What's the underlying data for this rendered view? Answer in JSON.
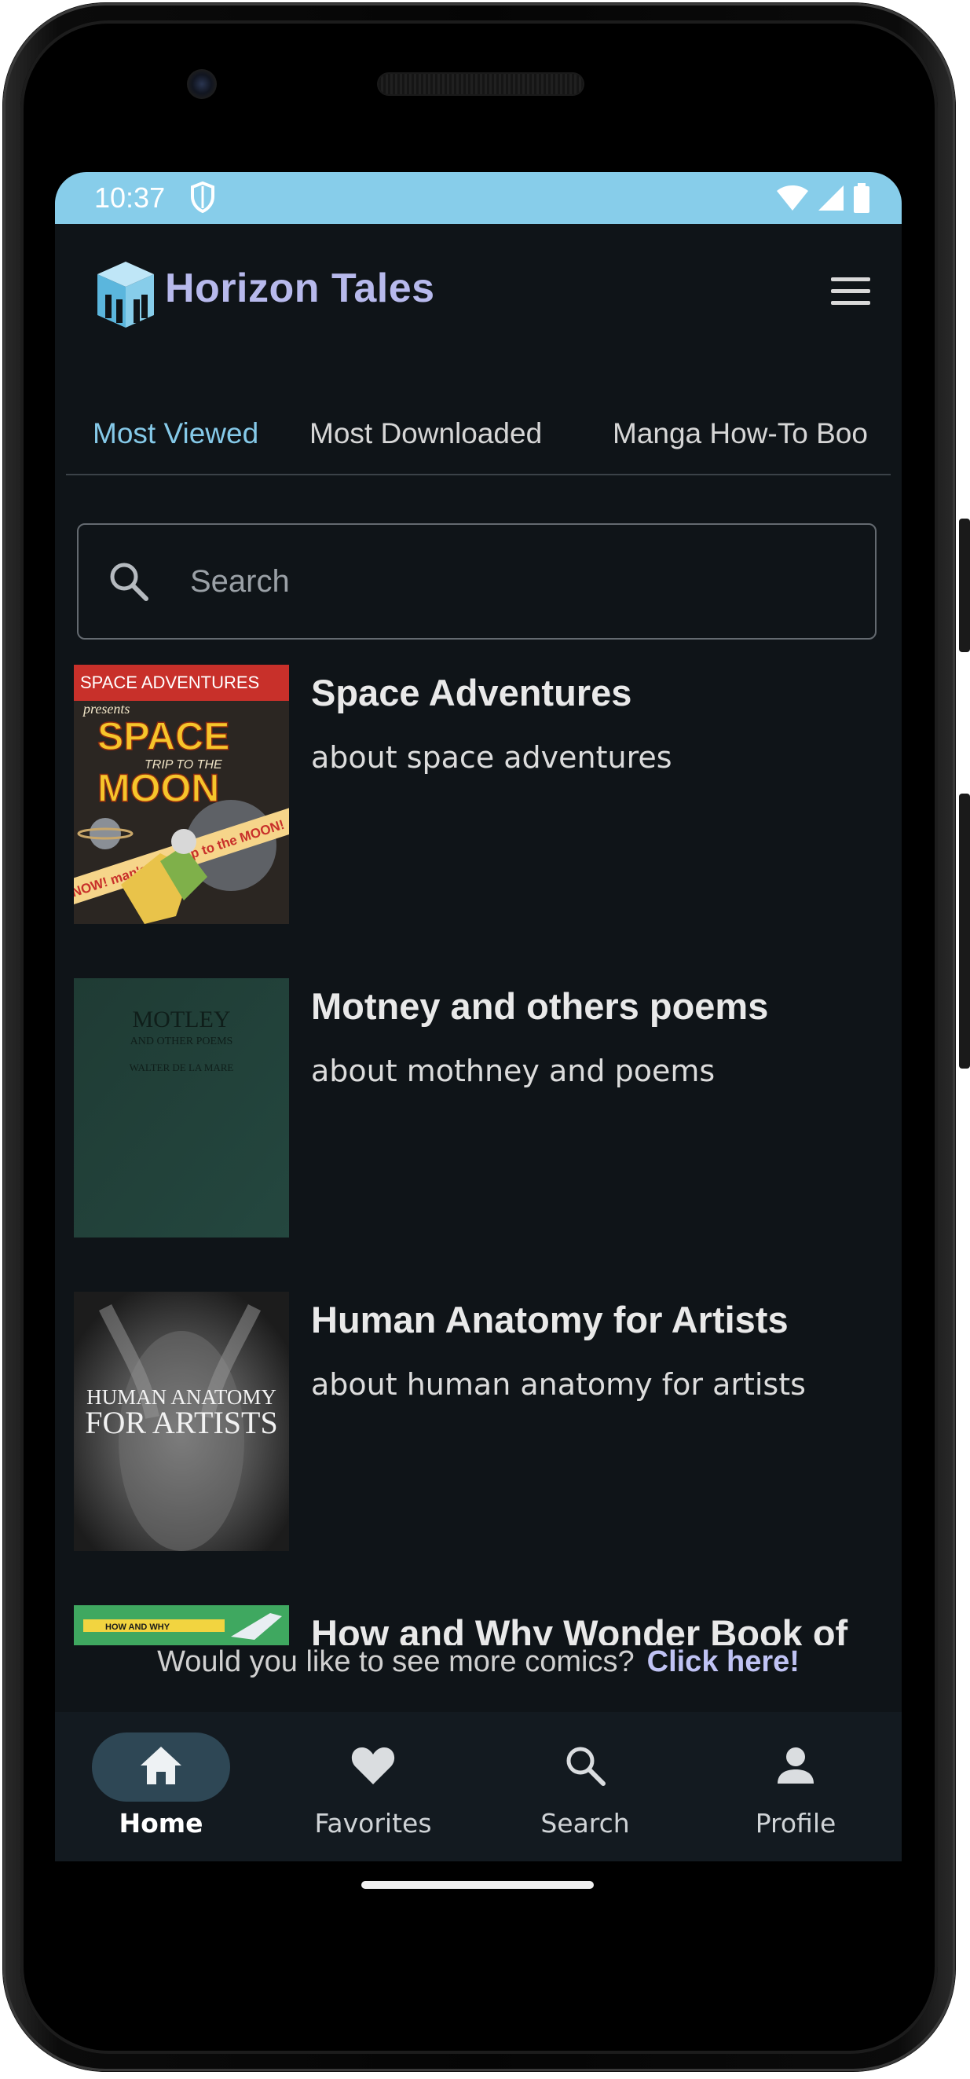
{
  "status": {
    "time": "10:37"
  },
  "app": {
    "brand": "Horizon Tales"
  },
  "tabs": [
    {
      "label": "Most Viewed",
      "active": true
    },
    {
      "label": "Most Downloaded",
      "active": false
    },
    {
      "label": "Manga How-To Boo",
      "active": false
    }
  ],
  "search": {
    "placeholder": "Search"
  },
  "items": [
    {
      "title": "Space Adventures",
      "desc": "about space adventures",
      "cover": {
        "line1": "SPACE ADVENTURES",
        "line2": "presents",
        "line3": "SPACE",
        "line4": "TRIP TO THE",
        "line5": "MOON",
        "line6": "NOW! man's first trip to the MOON!"
      }
    },
    {
      "title": "Motney and others poems",
      "desc": "about mothney and poems",
      "cover": {
        "line1": "MOTLEY",
        "line2": "AND OTHER POEMS",
        "line3": "WALTER DE LA MARE"
      }
    },
    {
      "title": "Human Anatomy for Artists",
      "desc": "about human anatomy for artists",
      "cover": {
        "line1": "HUMAN ANATOMY",
        "line2": "FOR ARTISTS"
      }
    },
    {
      "title": "How and Why Wonder Book of",
      "desc": "",
      "cover": {
        "line1": "HOW AND WHY"
      }
    }
  ],
  "promo": {
    "text": "Would you like to see more comics?",
    "link": "Click here!"
  },
  "nav": [
    {
      "label": "Home",
      "icon": "home-icon",
      "active": true
    },
    {
      "label": "Favorites",
      "icon": "heart-icon",
      "active": false
    },
    {
      "label": "Search",
      "icon": "search-icon",
      "active": false
    },
    {
      "label": "Profile",
      "icon": "person-icon",
      "active": false
    }
  ],
  "colors": {
    "statusbar": "#87cdea",
    "background": "#0f1418",
    "accent": "#85c9e8",
    "brand": "#b7b9ec",
    "link": "#c0c3f4"
  }
}
